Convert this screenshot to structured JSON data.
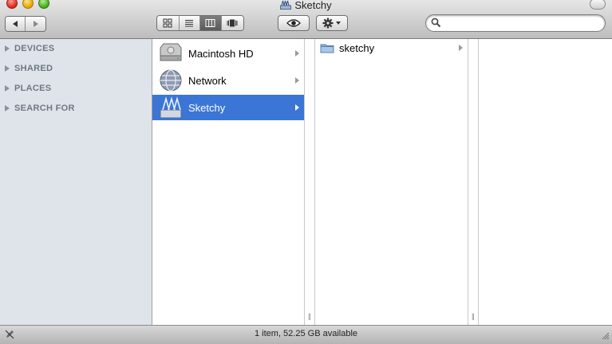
{
  "window": {
    "title": "Sketchy"
  },
  "toolbar": {
    "back_icon": "back-arrow-icon",
    "forward_icon": "forward-arrow-icon",
    "view_modes": [
      "icon-view-icon",
      "list-view-icon",
      "column-view-icon",
      "coverflow-view-icon"
    ],
    "active_view": "column",
    "quicklook_icon": "eye-icon",
    "action_icon": "gear-icon"
  },
  "search": {
    "value": "",
    "placeholder": ""
  },
  "sidebar": {
    "sections": [
      {
        "label": "DEVICES"
      },
      {
        "label": "SHARED"
      },
      {
        "label": "PLACES"
      },
      {
        "label": "SEARCH FOR"
      }
    ]
  },
  "column1": {
    "items": [
      {
        "label": "Macintosh HD",
        "icon": "hard-drive-icon",
        "selected": false
      },
      {
        "label": "Network",
        "icon": "network-globe-icon",
        "selected": false
      },
      {
        "label": "Sketchy",
        "icon": "disk-image-icon",
        "selected": true
      }
    ]
  },
  "column2": {
    "items": [
      {
        "label": "sketchy",
        "icon": "folder-icon",
        "selected": false
      }
    ]
  },
  "status": {
    "text": "1 item, 52.25 GB available"
  },
  "colors": {
    "selection": "#3b76d6",
    "sidebar_bg": "#dfe4ea",
    "section_text": "#6f7782"
  }
}
